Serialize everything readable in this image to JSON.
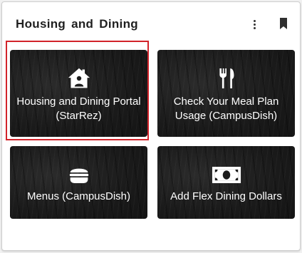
{
  "card": {
    "title": "Housing and Dining"
  },
  "icons": {
    "menu": "more-vert-icon",
    "bookmark": "bookmark-icon"
  },
  "tiles": [
    {
      "label": "Housing and Dining Portal (StarRez)",
      "icon": "house-person-icon",
      "selected": true
    },
    {
      "label": "Check Your Meal Plan Usage (CampusDish)",
      "icon": "fork-knife-icon"
    },
    {
      "label": "Menus (CampusDish)",
      "icon": "burger-icon"
    },
    {
      "label": "Add Flex Dining Dollars",
      "icon": "money-bill-icon"
    }
  ],
  "colors": {
    "highlight": "#d2232a",
    "tile_bg": "#1c1c1c"
  }
}
